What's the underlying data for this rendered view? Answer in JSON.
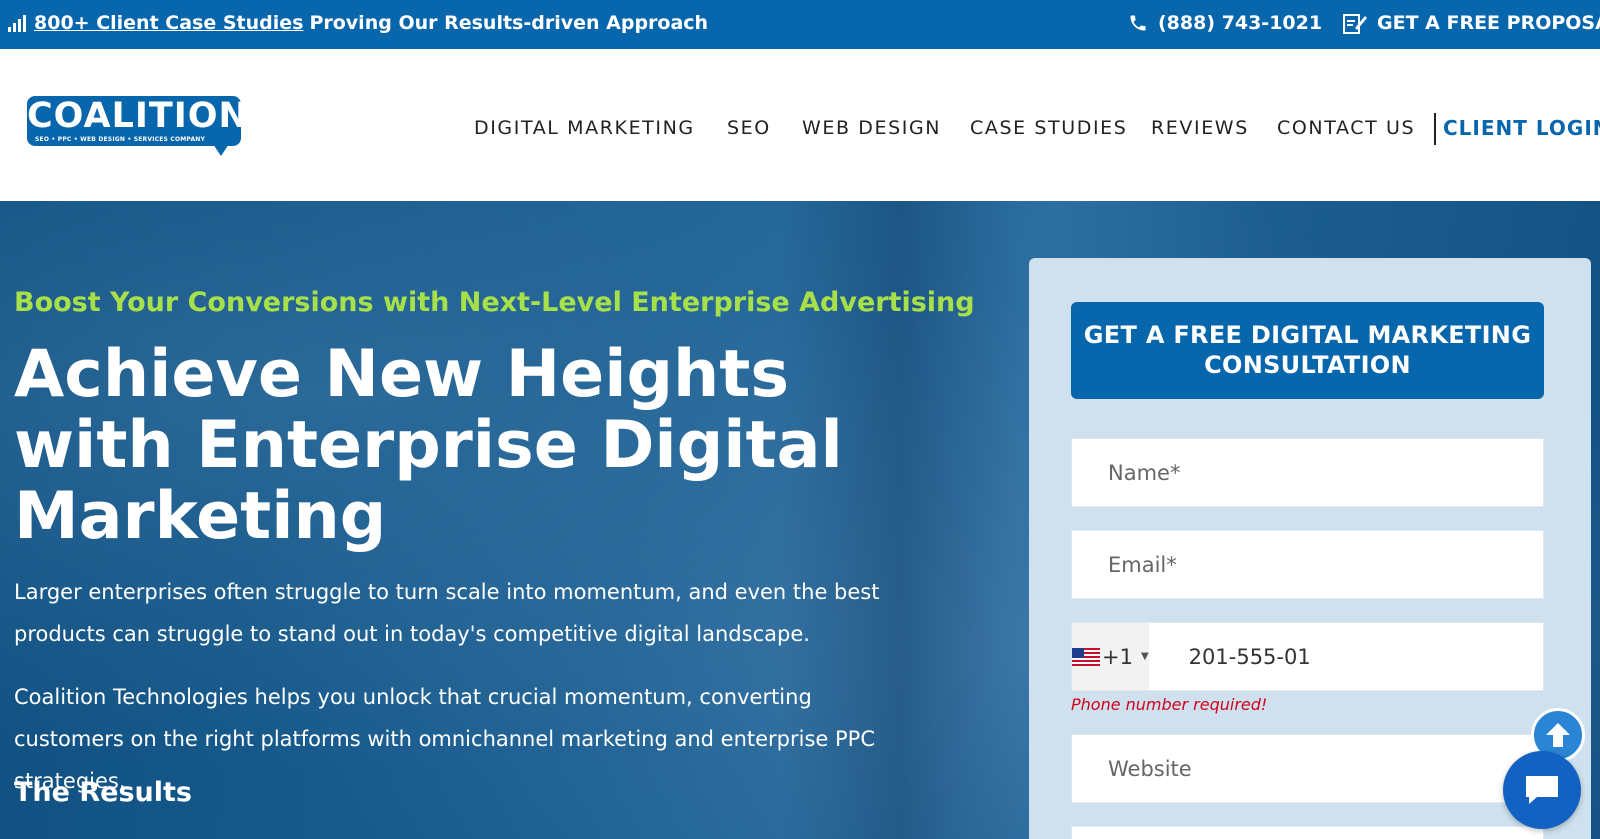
{
  "topbar": {
    "promo_link": "800+ Client Case Studies",
    "promo_text": "Proving Our Results-driven Approach",
    "phone": "(888) 743-1021",
    "proposal": "GET A FREE PROPOSAL",
    "icons": [
      "signal-bars-icon",
      "phone-icon",
      "proposal-icon"
    ]
  },
  "header": {
    "logo_text": "COALITION",
    "logo_tagline": "SEO • PPC • WEB DESIGN • SERVICES COMPANY",
    "nav": [
      "DIGITAL MARKETING",
      "SEO",
      "WEB DESIGN",
      "CASE STUDIES",
      "REVIEWS",
      "CONTACT US"
    ],
    "login": "CLIENT LOGIN"
  },
  "hero": {
    "subheading": "Boost Your Conversions with Next-Level Enterprise Advertising",
    "title": "Achieve New Heights with Enterprise Digital Marketing",
    "paragraph1": "Larger enterprises often struggle to turn scale into momentum, and even the best products can struggle to stand out in today's competitive digital landscape.",
    "paragraph2": "Coalition Technologies helps you unlock that crucial momentum, converting customers on the right platforms with omnichannel marketing and enterprise PPC strategies.",
    "results_heading": "The Results"
  },
  "form": {
    "cta": "GET A FREE DIGITAL MARKETING CONSULTATION",
    "name_placeholder": "Name*",
    "email_placeholder": "Email*",
    "country_code": "+1",
    "phone_value": "201-555-01",
    "phone_error": "Phone number required!",
    "website_placeholder": "Website"
  },
  "colors": {
    "brand_blue": "#0866ac",
    "accent_green": "#a8e04a",
    "error_red": "#d0021b"
  }
}
